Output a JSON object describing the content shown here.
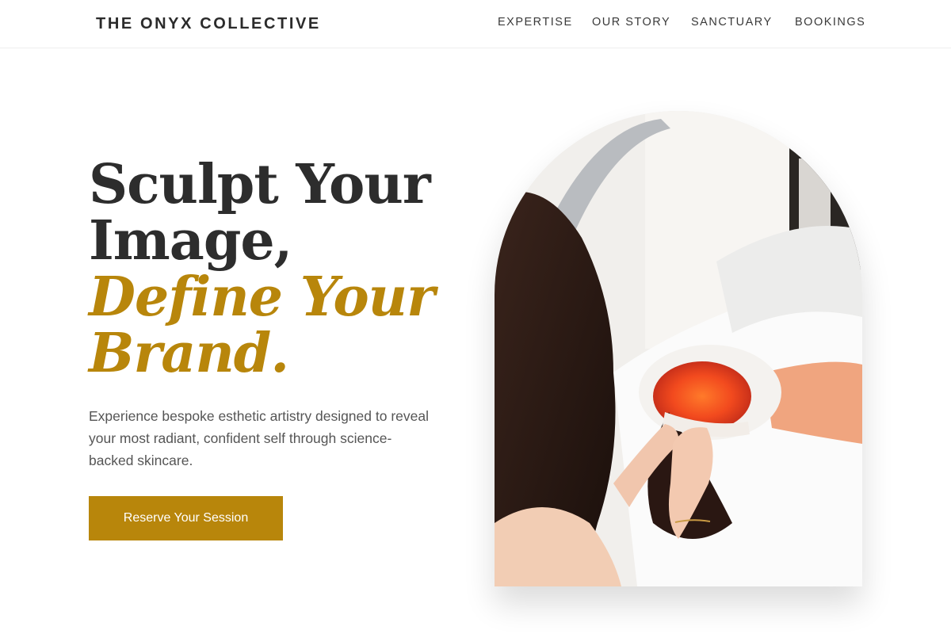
{
  "header": {
    "brand": "THE ONYX COLLECTIVE",
    "nav": [
      "EXPERTISE",
      "OUR STORY",
      "SANCTUARY",
      "BOOKINGS"
    ]
  },
  "hero": {
    "headline_line1": "Sculpt Your",
    "headline_line2": "Image,",
    "headline_accent1": "Define Your",
    "headline_accent2": "Brand.",
    "subtext": "Experience bespoke esthetic artistry designed to reveal your most radiant, confident self through science-backed skincare.",
    "cta_label": "Reserve Your Session"
  },
  "colors": {
    "accent": "#b8860b",
    "text": "#2d2d2d",
    "muted": "#555555"
  }
}
